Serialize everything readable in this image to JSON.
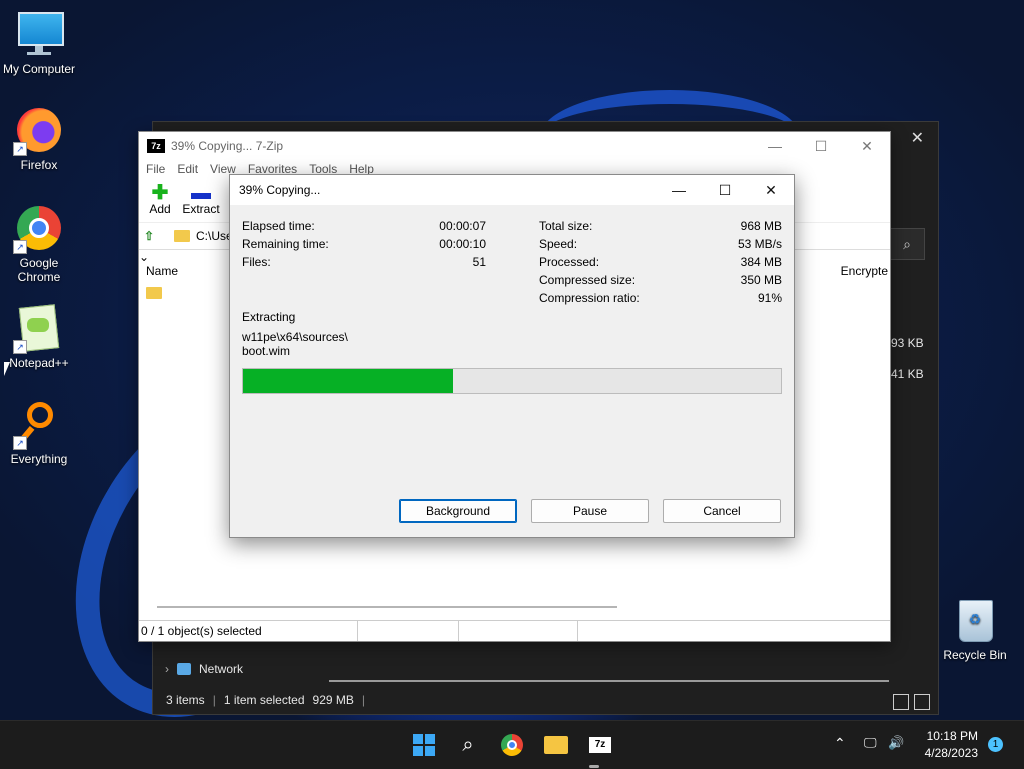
{
  "desktop": {
    "icons": [
      {
        "label": "My Computer",
        "icon": "monitor-icon"
      },
      {
        "label": "Firefox",
        "icon": "firefox-icon"
      },
      {
        "label": "Google Chrome",
        "icon": "chrome-icon"
      },
      {
        "label": "Notepad++",
        "icon": "notepadpp-icon"
      },
      {
        "label": "Everything",
        "icon": "everything-icon"
      },
      {
        "label": "Recycle Bin",
        "icon": "recycle-bin-icon"
      }
    ]
  },
  "explorer": {
    "partial_values": [
      "93 KB",
      "41 KB"
    ],
    "nav_network": "Network",
    "status": {
      "items": "3 items",
      "selected": "1 item selected",
      "size": "929 MB"
    }
  },
  "zip_window": {
    "title": "39% Copying... 7-Zip",
    "menu": [
      "File",
      "Edit",
      "View",
      "Favorites",
      "Tools",
      "Help"
    ],
    "toolbar": {
      "add": "Add",
      "extract": "Extract"
    },
    "address": "C:\\Use",
    "columns": {
      "name": "Name",
      "encrypted": "Encrypte"
    },
    "status": "0 / 1 object(s) selected"
  },
  "dialog": {
    "title": "39% Copying...",
    "left_stats": [
      {
        "label": "Elapsed time:",
        "value": "00:00:07"
      },
      {
        "label": "Remaining time:",
        "value": "00:00:10"
      },
      {
        "label": "Files:",
        "value": "51"
      }
    ],
    "right_stats": [
      {
        "label": "Total size:",
        "value": "968 MB"
      },
      {
        "label": "Speed:",
        "value": "53 MB/s"
      },
      {
        "label": "Processed:",
        "value": "384 MB"
      },
      {
        "label": "Compressed size:",
        "value": "350 MB"
      },
      {
        "label": "Compression ratio:",
        "value": "91%"
      }
    ],
    "action": "Extracting",
    "path_line1": "w11pe\\x64\\sources\\",
    "path_line2": "boot.wim",
    "progress": 0.39,
    "buttons": {
      "background": "Background",
      "pause": "Pause",
      "cancel": "Cancel"
    }
  },
  "taskbar": {
    "time": "10:18 PM",
    "date": "4/28/2023",
    "notification_count": "1"
  },
  "colors": {
    "progress": "#06b025",
    "accent": "#0067c0"
  }
}
